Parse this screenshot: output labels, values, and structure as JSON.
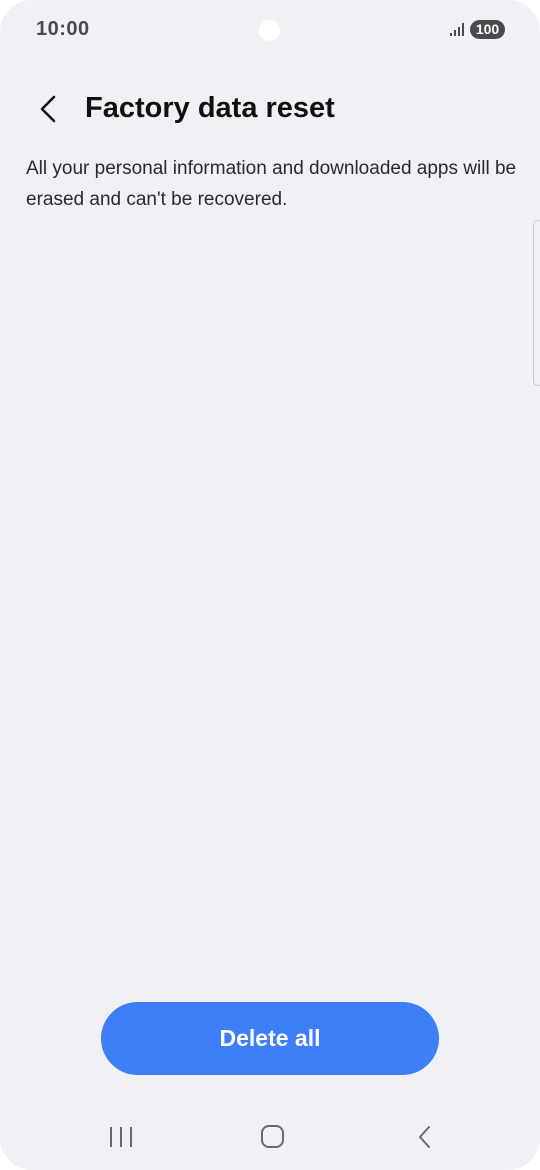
{
  "status_bar": {
    "time": "10:00",
    "battery": "100",
    "icons": [
      "signal-icon",
      "battery-icon"
    ]
  },
  "header": {
    "back_icon": "chevron-left-icon",
    "title": "Factory data reset"
  },
  "content": {
    "description": "All your personal information and downloaded apps will be erased and can't be recovered."
  },
  "actions": {
    "delete_label": "Delete all"
  },
  "navigation": {
    "icons": [
      "recents-icon",
      "home-icon",
      "back-icon"
    ]
  },
  "colors": {
    "background": "#f1f0f4",
    "accent": "#3e7ef8",
    "title_text": "#111111",
    "body_text": "#2a2a2a",
    "status_text": "#4a4a4e"
  }
}
